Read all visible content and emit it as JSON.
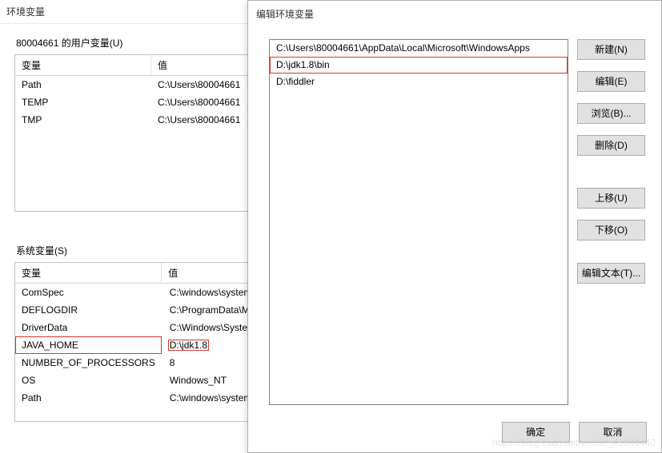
{
  "back_dialog": {
    "title": "环境变量",
    "user_section_label": "80004661 的用户变量(U)",
    "sys_section_label": "系统变量(S)",
    "columns": {
      "var": "变量",
      "val": "值"
    },
    "user_vars": [
      {
        "name": "Path",
        "value": "C:\\Users\\80004661"
      },
      {
        "name": "TEMP",
        "value": "C:\\Users\\80004661"
      },
      {
        "name": "TMP",
        "value": "C:\\Users\\80004661"
      }
    ],
    "sys_vars": [
      {
        "name": "ComSpec",
        "value": "C:\\windows\\system",
        "hl": false
      },
      {
        "name": "DEFLOGDIR",
        "value": "C:\\ProgramData\\M",
        "hl": false
      },
      {
        "name": "DriverData",
        "value": "C:\\Windows\\System",
        "hl": false
      },
      {
        "name": "JAVA_HOME",
        "value": "D:\\jdk1.8",
        "hl": true
      },
      {
        "name": "NUMBER_OF_PROCESSORS",
        "value": "8",
        "hl": false
      },
      {
        "name": "OS",
        "value": "Windows_NT",
        "hl": false
      },
      {
        "name": "Path",
        "value": "C:\\windows\\system",
        "hl": false
      }
    ]
  },
  "front_dialog": {
    "title": "编辑环境变量",
    "entries": [
      {
        "text": "C:\\Users\\80004661\\AppData\\Local\\Microsoft\\WindowsApps",
        "selected": false
      },
      {
        "text": "D:\\jdk1.8\\bin",
        "selected": true
      },
      {
        "text": "D:\\fiddler",
        "selected": false
      }
    ],
    "buttons": {
      "new": "新建(N)",
      "edit": "编辑(E)",
      "browse": "浏览(B)...",
      "delete": "删除(D)",
      "moveup": "上移(U)",
      "movedown": "下移(O)",
      "edittext": "编辑文本(T)...",
      "ok": "确定",
      "cancel": "取消"
    }
  },
  "watermark": "https://blog.csdn.net/weixin_43044440"
}
